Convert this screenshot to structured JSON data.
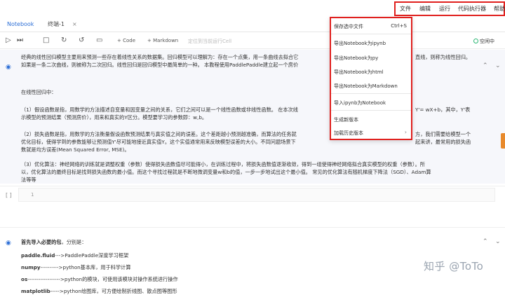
{
  "menubar": {
    "items": [
      "文件",
      "编辑",
      "运行",
      "代码执行器",
      "帮助"
    ]
  },
  "tabs": [
    {
      "label": "Notebook"
    },
    {
      "label": "终端-1"
    }
  ],
  "tab_close": "×",
  "toolbar": {
    "add_code": "+ Code",
    "add_markdown": "+ Markdown",
    "locate_cell": "定位到当前运行Cell",
    "kernel_status": "空闲中"
  },
  "cell1": {
    "lines": [
      "经典的线性回归模型主要用来预测一些存在着线性关系的数据集。回归模型可以理解为：存在一个点集，用一条曲线去拟合它",
      "如果是一条二次曲线，则被称为二次回归。线性回归是回归模型中最简单的一种。 本教程使用PaddlePaddle建立起一个房价",
      "",
      "在线性回归中：",
      "",
      "（1）假设函数是指，用数学的方法描述自变量和因变量之间的关系，它们之间可以是一个线性函数或非线性函数。 在本次线",
      "示模型的预测结果（预测房价），用来和真实的Y区分。模型要学习的参数即：w,b。",
      "",
      "（2）损失函数是指，用数学的方法衡量假设函数预测结果与真实值之间的误差。这个差距越小预测越准确，而算法的任务就",
      "优化目标，使得学到的参数能够让预测值Y'尽可能地接近真实值Y。这个实值通常用来反映模型误差的大小。不同问题场景下",
      "数就是均方误差(Mean Squared Error, MSE)。",
      "",
      "（3）优化算法：神经网络的训练就是调整权重（参数）使得损失函数值尽可能得小，在训练过程中，将损失函数值逐渐收敛，得到一组使得神经网络拟合真实模型的权重（参数）。所",
      "以，优化算法的最终目标是找到损失函数的最小值。而这个寻找过程就是不断地微调变量w和b的值，一步一步地试出这个最小值。 常见的优化算法有随机梯度下降法（SGD）、Adam算",
      "法等等"
    ],
    "right_fragments": [
      "直线，则称为线性回归。",
      "Y'= wX+b，其中，Y'表",
      "方，我们需要给模型一个",
      "起来讲，最常用的损失函"
    ]
  },
  "cell2": {
    "bracket": "[ ]",
    "line_no": "1"
  },
  "cell3": {
    "lines": [
      {
        "bold": "首先导入必要的包",
        "rest": "，分别是："
      },
      {
        "bold": "paddle.fluid",
        "rest": "--->PaddlePaddle深度学习框架"
      },
      {
        "bold": "numpy",
        "rest": "---------->python基本库，用于科学计算"
      },
      {
        "bold": "os",
        "rest": "------------------>python的模块，可使用该模块对操作系统进行操作"
      },
      {
        "bold": "matplotlib",
        "rest": "----->python绘图库，可方便绘制折线图、散点图等图形"
      }
    ]
  },
  "dropdown": {
    "items": [
      {
        "label": "保存选中文件",
        "shortcut": "Ctrl+S"
      },
      {
        "label": "导出Notebook为ipynb"
      },
      {
        "label": "导出Notebook为py"
      },
      {
        "label": "导出Notebook为html"
      },
      {
        "label": "导出Notebook为Markdown"
      },
      {
        "label": "导入ipynb为Notebook"
      },
      {
        "label": "生成新版本"
      },
      {
        "label": "加载历史版本"
      }
    ]
  },
  "watermark": "知乎 @ToTo",
  "colors": {
    "accent": "#2d6fd6",
    "highlight": "#e0201e",
    "kernel": "#2bb673"
  }
}
